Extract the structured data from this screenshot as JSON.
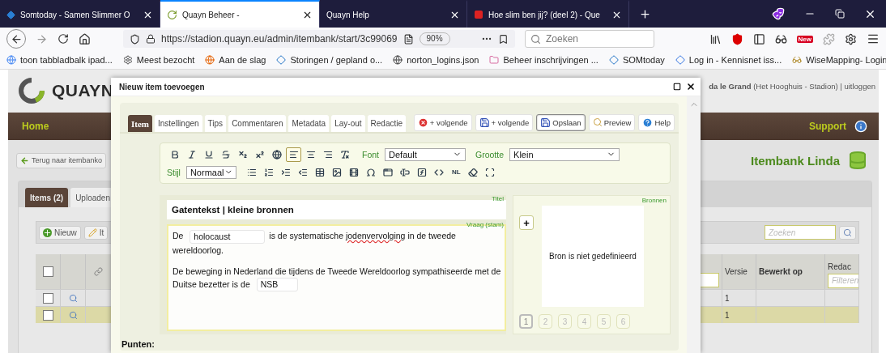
{
  "browser": {
    "tabs": [
      {
        "title": "Somtoday - Samen Slimmer O",
        "selected": false
      },
      {
        "title": "Quayn Beheer -",
        "selected": true
      },
      {
        "title": "Quayn Help",
        "selected": false
      },
      {
        "title": "Hoe slim ben jij? (deel 2) - Que",
        "selected": false
      }
    ],
    "url": "https://stadion.quayn.eu/admin/itembank/start/3c99069",
    "zoom": "90%",
    "search": {
      "placeholder": "Zoeken"
    },
    "badge": "New",
    "bookmarks": [
      "toon tabbladbalk ipad...",
      "Meest bezocht",
      "Aan de slag",
      "Storingen / gepland o...",
      "norton_logins.json",
      "Beheer inschrijvingen ...",
      "SOMtoday",
      "Log in - Kennisnet iss...",
      "WiseMapping- Login"
    ]
  },
  "app": {
    "logo": "QUAYN",
    "user": {
      "name": "da le Grand",
      "school": "(Het Hooghuis - Stadion)",
      "separator": "|",
      "logout": "uitloggen"
    },
    "nav": {
      "home": "Home",
      "support": "Support"
    },
    "back": "Terug naar itembanko",
    "heading": "Itembank Linda",
    "tabs": [
      {
        "label": "Items (2)",
        "selected": true
      },
      {
        "label": "Uploaden",
        "selected": false
      }
    ],
    "actions": [
      "Nieuw",
      "It"
    ],
    "search": {
      "placeholder": "Zoeken"
    },
    "columns": [
      "Versie",
      "Bewerkt op",
      "Redac"
    ],
    "filter": {
      "placeholder": "Filteren"
    },
    "select_all": {
      "checked": false
    },
    "rows": [
      {
        "version": "1",
        "selected": false,
        "checked": false
      },
      {
        "version": "1",
        "selected": true,
        "checked": false
      }
    ]
  },
  "dialog": {
    "title": "Nieuw item toevoegen",
    "tabs": [
      {
        "label": "Item",
        "selected": true
      },
      {
        "label": "Instellingen",
        "selected": false
      },
      {
        "label": "Tips",
        "selected": false
      },
      {
        "label": "Commentaren",
        "selected": false
      },
      {
        "label": "Metadata",
        "selected": false
      },
      {
        "label": "Lay-out",
        "selected": false
      },
      {
        "label": "Redactie",
        "selected": false
      }
    ],
    "buttons": [
      {
        "label": "+ volgende",
        "kind": "cancel",
        "selected": false
      },
      {
        "label": "+ volgende",
        "kind": "save",
        "selected": false
      },
      {
        "label": "Opslaan",
        "kind": "save",
        "selected": true
      },
      {
        "label": "Preview",
        "kind": "preview",
        "selected": false
      },
      {
        "label": "Help",
        "kind": "help",
        "selected": false
      }
    ],
    "editor": {
      "font_label": "Font",
      "font": "Default",
      "size_label": "Grootte",
      "size": "Klein",
      "style_label": "Stijl",
      "style": "Normaal",
      "row_1": [
        {
          "selected": false
        },
        {
          "selected": false
        },
        {
          "selected": false
        },
        {
          "selected": false
        },
        {
          "selected": false
        },
        {
          "selected": false
        },
        {
          "selected": false
        },
        {
          "selected": true
        },
        {
          "selected": false
        },
        {
          "selected": false
        },
        {
          "selected": false
        }
      ],
      "row_2": [
        {
          "selected": false
        },
        {
          "selected": false
        },
        {
          "selected": false
        },
        {
          "selected": false
        },
        {
          "selected": false
        },
        {
          "selected": false
        },
        {
          "selected": false
        },
        {
          "selected": false
        },
        {
          "selected": false
        },
        {
          "selected": false
        },
        {
          "selected": false
        },
        {
          "selected": false
        },
        {
          "selected": false,
          "label": "NL"
        },
        {
          "selected": false
        },
        {
          "selected": false
        }
      ]
    },
    "title_field": {
      "label": "Titel",
      "value": "Gatentekst | kleine bronnen"
    },
    "question": {
      "label": "Vraag (stam)",
      "paragraphs": [
        [
          {
            "kind": "text",
            "text": "De"
          },
          {
            "kind": "gap",
            "value": "holocaust"
          },
          {
            "kind": "text",
            "text": "is de systematische"
          },
          {
            "kind": "misspelled",
            "text": "jodenvervolging"
          },
          {
            "kind": "text",
            "text": "in de tweede"
          },
          {
            "kind": "text",
            "text": "wereldoorlog."
          }
        ],
        [
          {
            "kind": "text",
            "text": "De beweging in Nederland die tijdens de Tweede Wereldoorlog sympathiseerde met de"
          },
          {
            "kind": "text",
            "text": "Duitse bezetter is de"
          },
          {
            "kind": "gap",
            "value": "NSB"
          }
        ]
      ]
    },
    "sources": {
      "label": "Bronnen",
      "add": "+",
      "empty": "Bron is niet gedefinieerd",
      "pages": [
        {
          "label": "1",
          "selected": true
        },
        {
          "label": "2",
          "selected": false
        },
        {
          "label": "3",
          "selected": false
        },
        {
          "label": "4",
          "selected": false
        },
        {
          "label": "5",
          "selected": false
        },
        {
          "label": "6",
          "selected": false
        }
      ]
    },
    "points_label": "Punten:"
  }
}
